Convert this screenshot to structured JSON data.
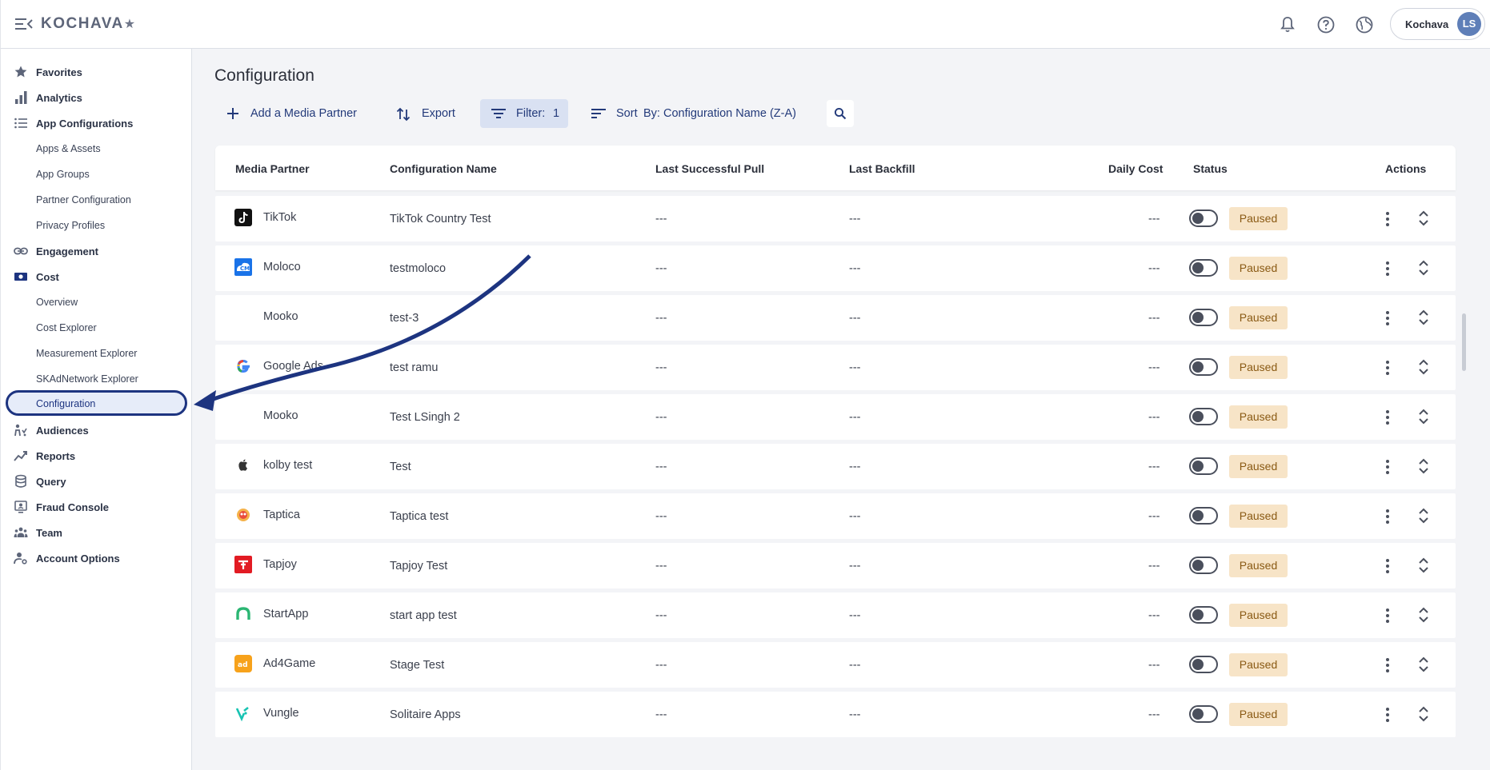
{
  "app": {
    "logo_text": "KOCHAVA",
    "logo_star": "★",
    "account_name": "Kochava",
    "account_initials": "LS"
  },
  "sidebar": {
    "items": [
      {
        "label": "Favorites",
        "icon": "star-icon"
      },
      {
        "label": "Analytics",
        "icon": "bar-chart-icon"
      },
      {
        "label": "App Configurations",
        "icon": "list-icon"
      },
      {
        "label": "Apps & Assets",
        "sub": true
      },
      {
        "label": "App Groups",
        "sub": true
      },
      {
        "label": "Partner Configuration",
        "sub": true
      },
      {
        "label": "Privacy Profiles",
        "sub": true
      },
      {
        "label": "Engagement",
        "icon": "link-icon"
      },
      {
        "label": "Cost",
        "icon": "money-icon"
      },
      {
        "label": "Overview",
        "sub": true
      },
      {
        "label": "Cost Explorer",
        "sub": true
      },
      {
        "label": "Measurement Explorer",
        "sub": true
      },
      {
        "label": "SKAdNetwork Explorer",
        "sub": true
      },
      {
        "label": "Configuration",
        "sub": true,
        "active": true
      },
      {
        "label": "Audiences",
        "icon": "audiences-icon"
      },
      {
        "label": "Reports",
        "icon": "trend-icon"
      },
      {
        "label": "Query",
        "icon": "database-icon"
      },
      {
        "label": "Fraud Console",
        "icon": "fraud-icon"
      },
      {
        "label": "Team",
        "icon": "team-icon"
      },
      {
        "label": "Account Options",
        "icon": "account-settings-icon"
      }
    ]
  },
  "main": {
    "title": "Configuration",
    "toolbar": {
      "add_label": "Add a Media Partner",
      "export_label": "Export",
      "filter_label": "Filter:",
      "filter_count": "1",
      "sort_label": "Sort",
      "sort_value": "By: Configuration Name (Z-A)"
    },
    "columns": {
      "media_partner": "Media Partner",
      "config_name": "Configuration Name",
      "last_pull": "Last Successful Pull",
      "last_backfill": "Last Backfill",
      "daily_cost": "Daily Cost",
      "status": "Status",
      "actions": "Actions"
    },
    "rows": [
      {
        "partner": "TikTok",
        "config": "TikTok Country Test",
        "pull": "---",
        "backfill": "---",
        "cost": "---",
        "status": "Paused",
        "logo": "tiktok"
      },
      {
        "partner": "Moloco",
        "config": "testmoloco",
        "pull": "---",
        "backfill": "---",
        "cost": "---",
        "status": "Paused",
        "logo": "moloco"
      },
      {
        "partner": "Mooko",
        "config": "test-3",
        "pull": "---",
        "backfill": "---",
        "cost": "---",
        "status": "Paused",
        "logo": "none"
      },
      {
        "partner": "Google Ads",
        "config": "test ramu",
        "pull": "---",
        "backfill": "---",
        "cost": "---",
        "status": "Paused",
        "logo": "google"
      },
      {
        "partner": "Mooko",
        "config": "Test LSingh 2",
        "pull": "---",
        "backfill": "---",
        "cost": "---",
        "status": "Paused",
        "logo": "none"
      },
      {
        "partner": "kolby test",
        "config": "Test",
        "pull": "---",
        "backfill": "---",
        "cost": "---",
        "status": "Paused",
        "logo": "apple"
      },
      {
        "partner": "Taptica",
        "config": "Taptica test",
        "pull": "---",
        "backfill": "---",
        "cost": "---",
        "status": "Paused",
        "logo": "taptica"
      },
      {
        "partner": "Tapjoy",
        "config": "Tapjoy Test",
        "pull": "---",
        "backfill": "---",
        "cost": "---",
        "status": "Paused",
        "logo": "tapjoy"
      },
      {
        "partner": "StartApp",
        "config": "start app test",
        "pull": "---",
        "backfill": "---",
        "cost": "---",
        "status": "Paused",
        "logo": "startapp"
      },
      {
        "partner": "Ad4Game",
        "config": "Stage Test",
        "pull": "---",
        "backfill": "---",
        "cost": "---",
        "status": "Paused",
        "logo": "ad4game"
      },
      {
        "partner": "Vungle",
        "config": "Solitaire Apps",
        "pull": "---",
        "backfill": "---",
        "cost": "---",
        "status": "Paused",
        "logo": "vungle"
      }
    ]
  },
  "colors": {
    "accent": "#1d3480",
    "paused_bg": "#f7e4c7",
    "paused_text": "#8a5a14"
  }
}
